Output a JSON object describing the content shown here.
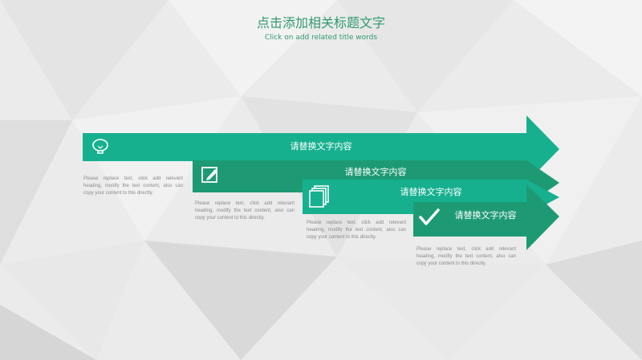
{
  "header": {
    "title": "点击添加相关标题文字",
    "subtitle": "Click on add related title words"
  },
  "steps": [
    {
      "label": "请替换文字内容",
      "icon": "lightbulb-icon",
      "color": "#16b08f",
      "text": "Please replace text, click add relevant heading, modify the text content, also can copy your content to this directly."
    },
    {
      "label": "请替换文字内容",
      "icon": "edit-note-icon",
      "color": "#1d9a74",
      "text": "Please replace text, click add relevant heading, modify the text content, also can copy your content to this directly."
    },
    {
      "label": "请替换文字内容",
      "icon": "stacked-pages-icon",
      "color": "#16b08f",
      "text": "Please replace text, click add relevant heading, modify the text content, also can copy your content to this directly."
    },
    {
      "label": "请替换文字内容",
      "icon": "checkmark-icon",
      "color": "#1d9a74",
      "text": "Please replace text, click add relevant heading, modify the text content, also can copy your content to this directly."
    }
  ]
}
